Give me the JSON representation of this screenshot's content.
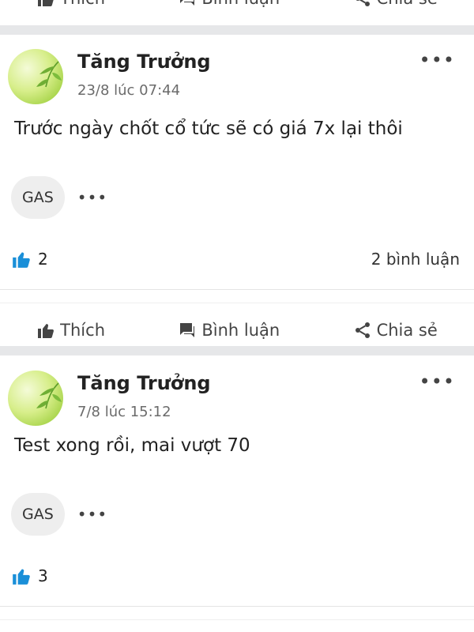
{
  "actions": {
    "like_label": "Thích",
    "comment_label": "Bình luận",
    "share_label": "Chia sẻ"
  },
  "posts": [
    {
      "author": "Tăng Trưởng",
      "timestamp": "23/8 lúc 07:44",
      "content": "Trước ngày chốt cổ tức sẽ có giá 7x lại thôi",
      "tag": "GAS",
      "tag_more": "•••",
      "likes": "2",
      "comments": "2 bình luận",
      "more": "•••"
    },
    {
      "author": "Tăng Trưởng",
      "timestamp": "7/8 lúc 15:12",
      "content": "Test xong rồi, mai vượt 70",
      "tag": "GAS",
      "tag_more": "•••",
      "likes": "3",
      "comments": "",
      "more": "•••"
    }
  ],
  "colors": {
    "like_icon": "#1a8fd8",
    "separator": "#e6e7e9",
    "tag_bg": "#eeeeee"
  }
}
